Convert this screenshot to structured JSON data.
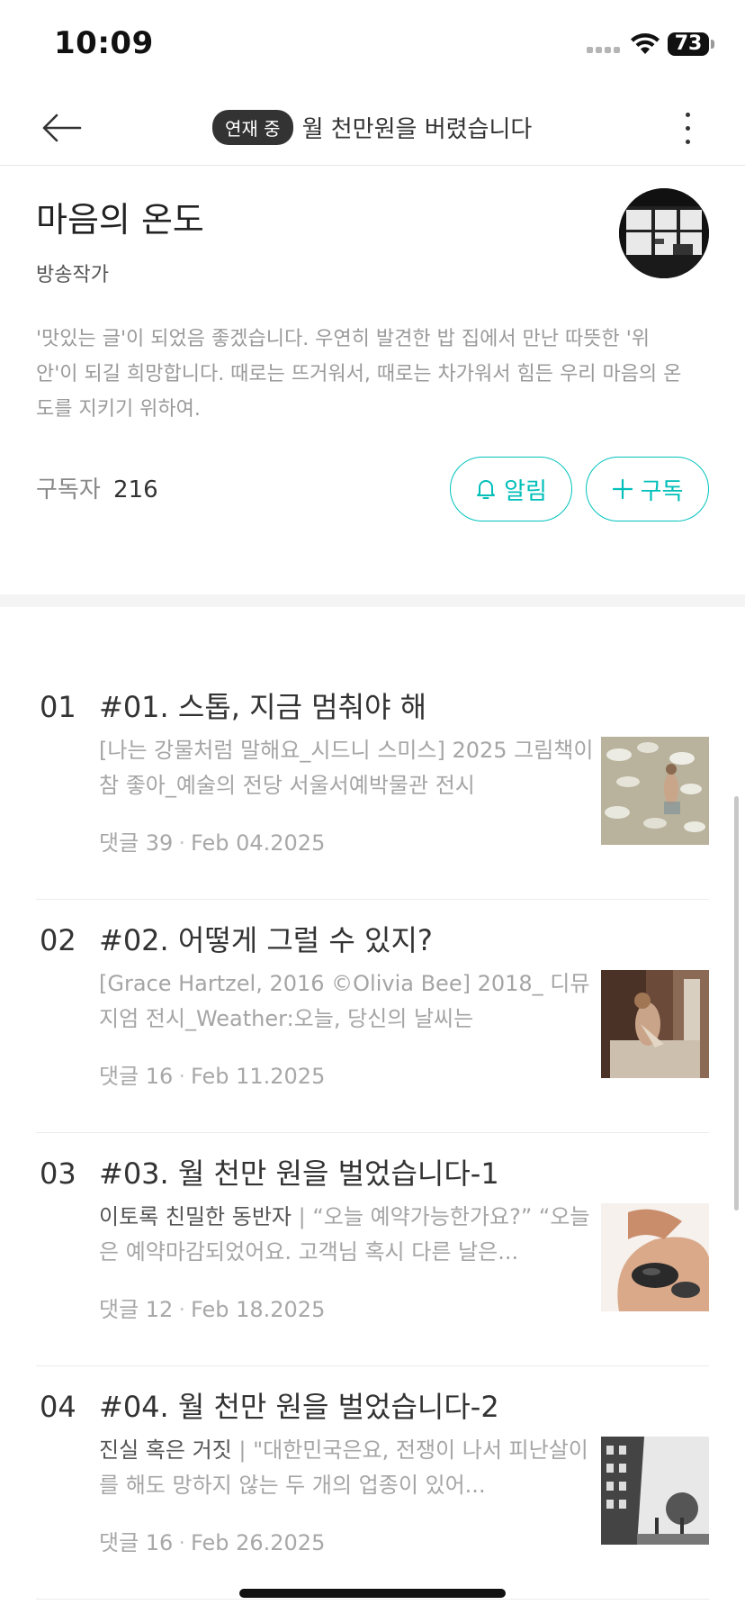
{
  "status_bar": {
    "time": "10:09",
    "battery": "73",
    "icons": [
      "signal-dots-icon",
      "wifi-icon",
      "battery-icon"
    ]
  },
  "header": {
    "status_badge": "연재 중",
    "title": "월 천만원을 버렸습니다",
    "back_icon": "arrow-left-icon",
    "more_icon": "more-vertical-icon"
  },
  "author": {
    "name": "마음의 온도",
    "role": "방송작가",
    "description": "'맛있는 글'이 되었음 좋겠습니다. 우연히 발견한 밥 집에서 만난 따뜻한 '위안'이 되길 희망합니다. 때로는 뜨거워서, 때로는 차가워서 힘든 우리 마음의 온도를 지키기 위하여.",
    "subscriber_label": "구독자",
    "subscriber_count": "216",
    "alarm_label": "알림",
    "subscribe_label": "구독"
  },
  "episodes": [
    {
      "number": "01",
      "title": "#01. 스톱, 지금 멈춰야 해",
      "excerpt_emph": "",
      "excerpt": "[나는 강물처럼 말해요_시드니 스미스]  2025 그림책이 참 좋아_예술의 전당 서울서예박물관 전시",
      "comments": "댓글 39",
      "date": "Feb 04.2025"
    },
    {
      "number": "02",
      "title": "#02. 어떻게 그럴 수 있지?",
      "excerpt_emph": "",
      "excerpt": "[Grace Hartzel, 2016 ©Olivia Bee] 2018_ 디뮤지엄 전시_Weather:오늘, 당신의 날씨는",
      "comments": "댓글 16",
      "date": "Feb 11.2025"
    },
    {
      "number": "03",
      "title": "#03. 월 천만 원을 벌었습니다-1",
      "excerpt_emph": "이토록 친밀한 동반자",
      "excerpt": " | “오늘 예약가능한가요?” “오늘은 예약마감되었어요. 고객님 혹시 다른 날은...",
      "comments": "댓글 12",
      "date": "Feb 18.2025"
    },
    {
      "number": "04",
      "title": "#04. 월 천만 원을 벌었습니다-2",
      "excerpt_emph": "진실 혹은 거짓",
      "excerpt": " | \"대한민국은요, 전쟁이 나서 피난살이를 해도 망하지 않는 두 개의 업종이 있어...",
      "comments": "댓글 16",
      "date": "Feb 26.2025"
    }
  ],
  "colors": {
    "accent": "#00bfb9",
    "badge_bg": "#333333",
    "muted_text": "#a5a5a5"
  }
}
